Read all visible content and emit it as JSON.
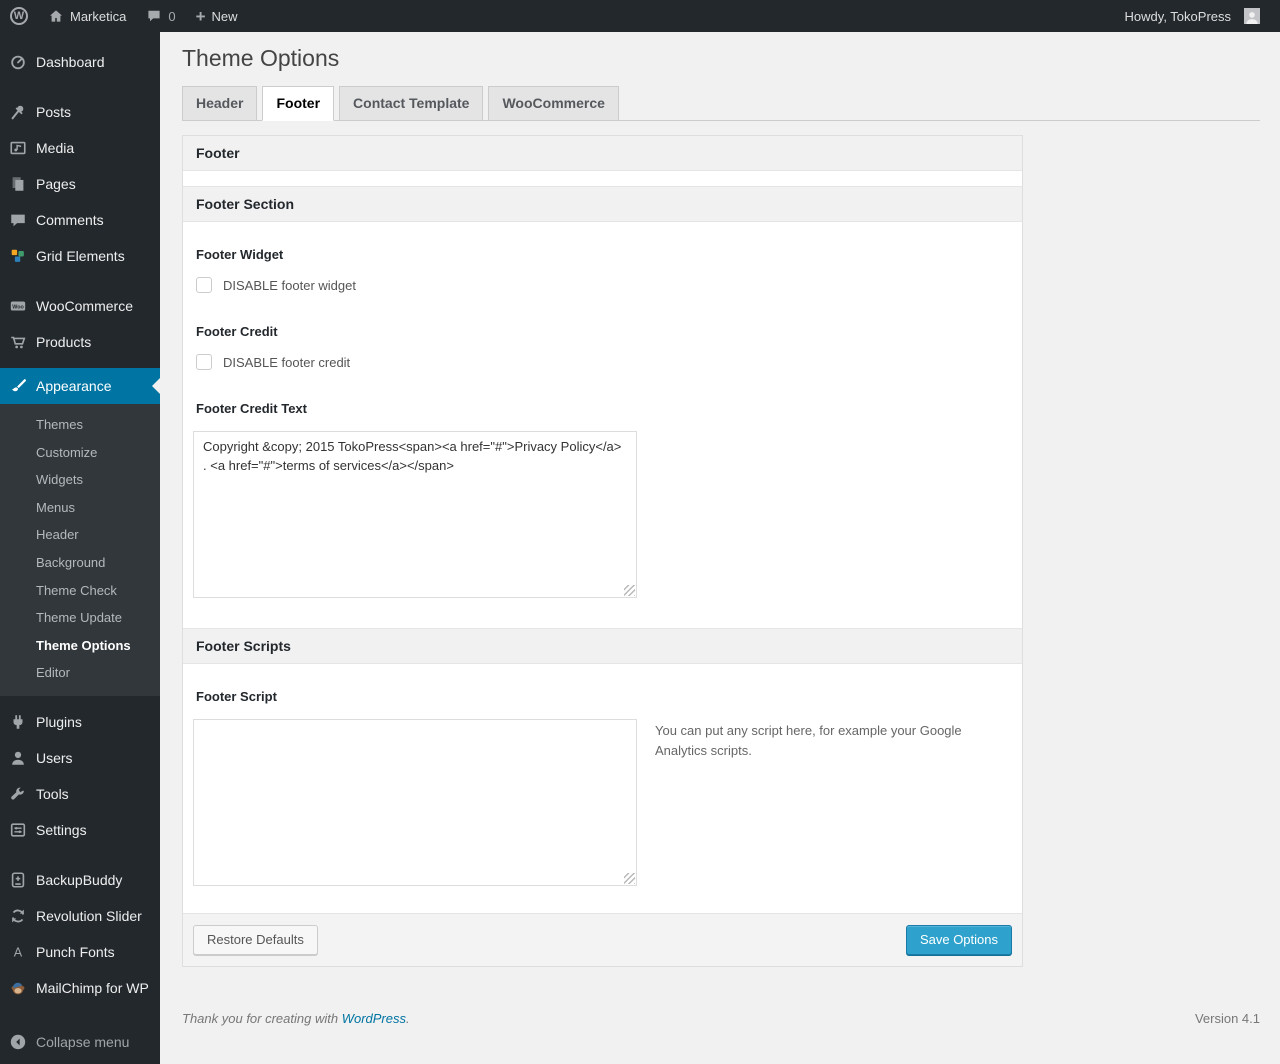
{
  "admin_bar": {
    "site_name": "Marketica",
    "comment_count": "0",
    "new_label": "New",
    "howdy": "Howdy, TokoPress"
  },
  "sidebar": {
    "items": [
      {
        "label": "Dashboard"
      },
      {
        "label": "Posts"
      },
      {
        "label": "Media"
      },
      {
        "label": "Pages"
      },
      {
        "label": "Comments"
      },
      {
        "label": "Grid Elements"
      },
      {
        "label": "WooCommerce"
      },
      {
        "label": "Products"
      },
      {
        "label": "Appearance"
      },
      {
        "label": "Plugins"
      },
      {
        "label": "Users"
      },
      {
        "label": "Tools"
      },
      {
        "label": "Settings"
      },
      {
        "label": "BackupBuddy"
      },
      {
        "label": "Revolution Slider"
      },
      {
        "label": "Punch Fonts"
      },
      {
        "label": "MailChimp for WP"
      }
    ],
    "appearance_submenu": [
      {
        "label": "Themes",
        "current": false
      },
      {
        "label": "Customize",
        "current": false
      },
      {
        "label": "Widgets",
        "current": false
      },
      {
        "label": "Menus",
        "current": false
      },
      {
        "label": "Header",
        "current": false
      },
      {
        "label": "Background",
        "current": false
      },
      {
        "label": "Theme Check",
        "current": false
      },
      {
        "label": "Theme Update",
        "current": false
      },
      {
        "label": "Theme Options",
        "current": true
      },
      {
        "label": "Editor",
        "current": false
      }
    ],
    "collapse_label": "Collapse menu"
  },
  "page": {
    "title": "Theme Options",
    "tabs": [
      {
        "label": "Header",
        "active": false
      },
      {
        "label": "Footer",
        "active": true
      },
      {
        "label": "Contact Template",
        "active": false
      },
      {
        "label": "WooCommerce",
        "active": false
      }
    ],
    "panel": {
      "heading": "Footer",
      "section_footer": {
        "title": "Footer Section",
        "footer_widget_label": "Footer Widget",
        "footer_widget_checkbox_label": "DISABLE footer widget",
        "footer_widget_checked": false,
        "footer_credit_label": "Footer Credit",
        "footer_credit_checkbox_label": "DISABLE footer credit",
        "footer_credit_checked": false,
        "footer_credit_text_label": "Footer Credit Text",
        "footer_credit_text_value": "Copyright &copy; 2015 TokoPress<span><a href=\"#\">Privacy Policy</a> . <a href=\"#\">terms of services</a></span>"
      },
      "section_scripts": {
        "title": "Footer Scripts",
        "footer_script_label": "Footer Script",
        "footer_script_value": "",
        "hint": "You can put any script here, for example your Google Analytics scripts."
      },
      "restore_button": "Restore Defaults",
      "save_button": "Save Options"
    },
    "footer": {
      "thanks_prefix": "Thank you for creating with ",
      "wordpress_link": "WordPress",
      "thanks_suffix": ".",
      "version": "Version 4.1"
    }
  },
  "colors": {
    "admin_dark": "#23282d",
    "submenu_bg": "#32373c",
    "accent_blue": "#0074a2",
    "save_button_bg": "#2ea2cc",
    "body_bg": "#f1f1f1"
  }
}
